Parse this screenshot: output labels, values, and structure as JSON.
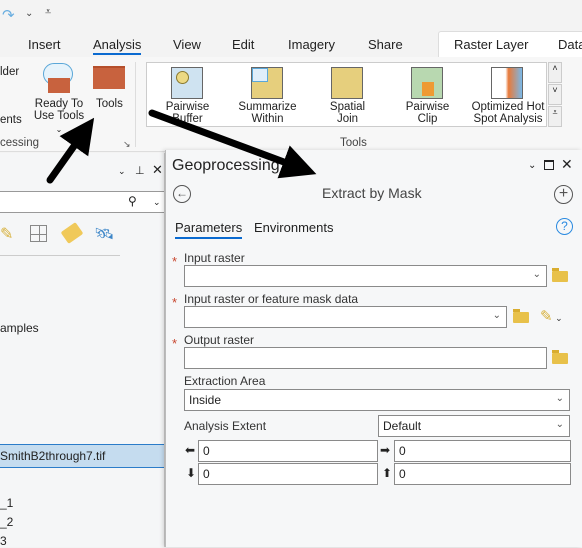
{
  "qat": {
    "redo_icon": "redo-icon",
    "dropdown": "chevron-down-icon",
    "customize": "customize-icon"
  },
  "ribbon": {
    "tabs": [
      "Insert",
      "Analysis",
      "View",
      "Edit",
      "Imagery",
      "Share"
    ],
    "contextual_tabs": [
      "Raster Layer",
      "Data"
    ],
    "active_tab": "Analysis",
    "left_partial": {
      "builder": "lder",
      "ents": "ents",
      "group": "cessing"
    },
    "ready_to_use": "Ready To\nUse Tools",
    "ready_line1": "Ready To",
    "ready_line2": "Use Tools",
    "tools_label": "Tools",
    "gallery": [
      {
        "l1": "Pairwise",
        "l2": "Buffer"
      },
      {
        "l1": "Summarize",
        "l2": "Within"
      },
      {
        "l1": "Spatial",
        "l2": "Join"
      },
      {
        "l1": "Pairwise",
        "l2": "Clip"
      },
      {
        "l1": "Optimized Hot",
        "l2": "Spot Analysis"
      }
    ],
    "gallery_group": "Tools"
  },
  "left_pane": {
    "items": [
      "amples",
      "SmithB2through7.tif",
      "_1",
      "_2",
      "3"
    ]
  },
  "geoprocessing": {
    "title": "Geoprocessing",
    "tool_title": "Extract by Mask",
    "tabs": [
      "Parameters",
      "Environments"
    ],
    "params": {
      "input_raster": {
        "label": "Input raster",
        "value": ""
      },
      "mask": {
        "label": "Input raster or feature mask data",
        "value": ""
      },
      "output": {
        "label": "Output raster",
        "value": ""
      },
      "extraction_area": {
        "label": "Extraction Area",
        "value": "Inside"
      },
      "analysis_extent": {
        "label": "Analysis Extent",
        "value": "Default"
      },
      "extent": {
        "left": "0",
        "right": "0",
        "bottom": "0",
        "top": "0"
      }
    }
  },
  "colors": {
    "accent": "#0a6ad0",
    "required": "#c8462e",
    "selected_row": "#c5dcef",
    "toolbox": "#c8623e"
  }
}
